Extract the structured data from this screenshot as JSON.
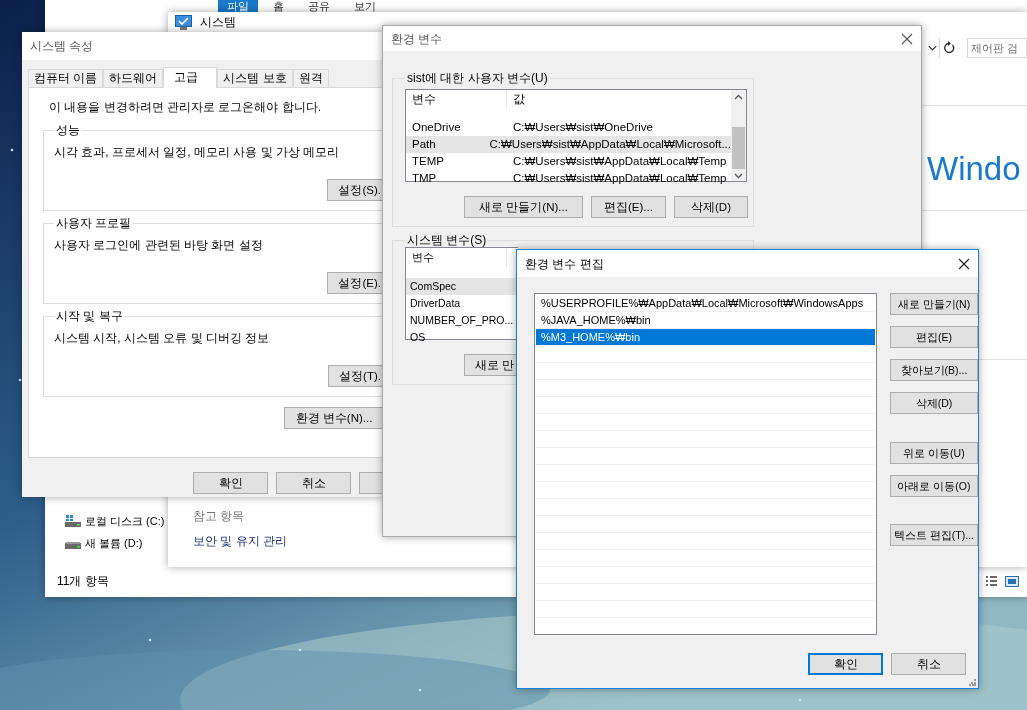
{
  "explorer": {
    "ribbon_tabs": [
      {
        "label": "파일",
        "selected": true
      },
      {
        "label": "홈",
        "selected": false
      },
      {
        "label": "공유",
        "selected": false
      },
      {
        "label": "보기",
        "selected": false
      }
    ],
    "nav_items": [
      {
        "label": "로컬 디스크 (C:)",
        "kind": "system-drive"
      },
      {
        "label": "새 볼륨 (D:)",
        "kind": "drive"
      }
    ],
    "status_bar": "11개 항목"
  },
  "system_window": {
    "title": "시스템",
    "search": {
      "placeholder": "제어판 검"
    },
    "heading": "Windo",
    "see_also": {
      "title": "참고 항목",
      "links": [
        "보안 및 유지 관리"
      ]
    }
  },
  "system_properties": {
    "title": "시스템 속성",
    "tabs": [
      {
        "label": "컴퓨터 이름",
        "selected": false
      },
      {
        "label": "하드웨어",
        "selected": false
      },
      {
        "label": "고급",
        "selected": true
      },
      {
        "label": "시스템 보호",
        "selected": false
      },
      {
        "label": "원격",
        "selected": false
      }
    ],
    "notice": "이 내용을 변경하려면 관리자로 로그온해야 합니다.",
    "groups": [
      {
        "title": "성능",
        "description": "시각 효과, 프로세서 일정, 메모리 사용 및 가상 메모리",
        "button": "설정(S)."
      },
      {
        "title": "사용자 프로필",
        "description": "사용자 로그인에 관련된 바탕 화면 설정",
        "button": "설정(E)."
      },
      {
        "title": "시작 및 복구",
        "description": "시스템 시작, 시스템 오류 및 디버깅 정보",
        "button": "설정(T)."
      }
    ],
    "env_button": "환경 변수(N)...",
    "buttons": [
      "확인",
      "취소"
    ]
  },
  "env_vars": {
    "title": "환경 변수",
    "user_group": {
      "title": "sist에 대한 사용자 변수(U)",
      "columns": [
        "변수",
        "값"
      ],
      "rows": [
        {
          "name": "OneDrive",
          "value": "C:₩Users₩sist₩OneDrive",
          "selected": false
        },
        {
          "name": "Path",
          "value": "C:₩Users₩sist₩AppData₩Local₩Microsoft...",
          "selected": true
        },
        {
          "name": "TEMP",
          "value": "C:₩Users₩sist₩AppData₩Local₩Temp",
          "selected": false
        },
        {
          "name": "TMP",
          "value": "C:₩Users₩sist₩AppData₩Local₩Temp",
          "selected": false
        }
      ],
      "buttons": [
        "새로 만들기(N)...",
        "편집(E)...",
        "삭제(D)"
      ]
    },
    "system_group": {
      "title": "시스템 변수(S)",
      "columns": [
        "변수"
      ],
      "rows": [
        {
          "name": "ComSpec",
          "selected": true
        },
        {
          "name": "DriverData",
          "selected": false
        },
        {
          "name": "NUMBER_OF_PRO...",
          "selected": false
        },
        {
          "name": "OS",
          "selected": false
        }
      ],
      "buttons": [
        "새로 만"
      ]
    }
  },
  "edit_dialog": {
    "title": "환경 변수 편집",
    "entries": [
      {
        "text": "%USERPROFILE%₩AppData₩Local₩Microsoft₩WindowsApps",
        "selected": false
      },
      {
        "text": "%JAVA_HOME%₩bin",
        "selected": false
      },
      {
        "text": "%M3_HOME%₩bin",
        "selected": true
      }
    ],
    "button_groups": [
      [
        "새로 만들기(N)",
        "편집(E)",
        "찾아보기(B)...",
        "삭제(D)"
      ],
      [
        "위로 이동(U)",
        "아래로 이동(O)"
      ],
      [
        "텍스트 편집(T)..."
      ]
    ],
    "footer_buttons": [
      {
        "label": "확인",
        "default": true
      },
      {
        "label": "취소",
        "default": false
      }
    ]
  }
}
